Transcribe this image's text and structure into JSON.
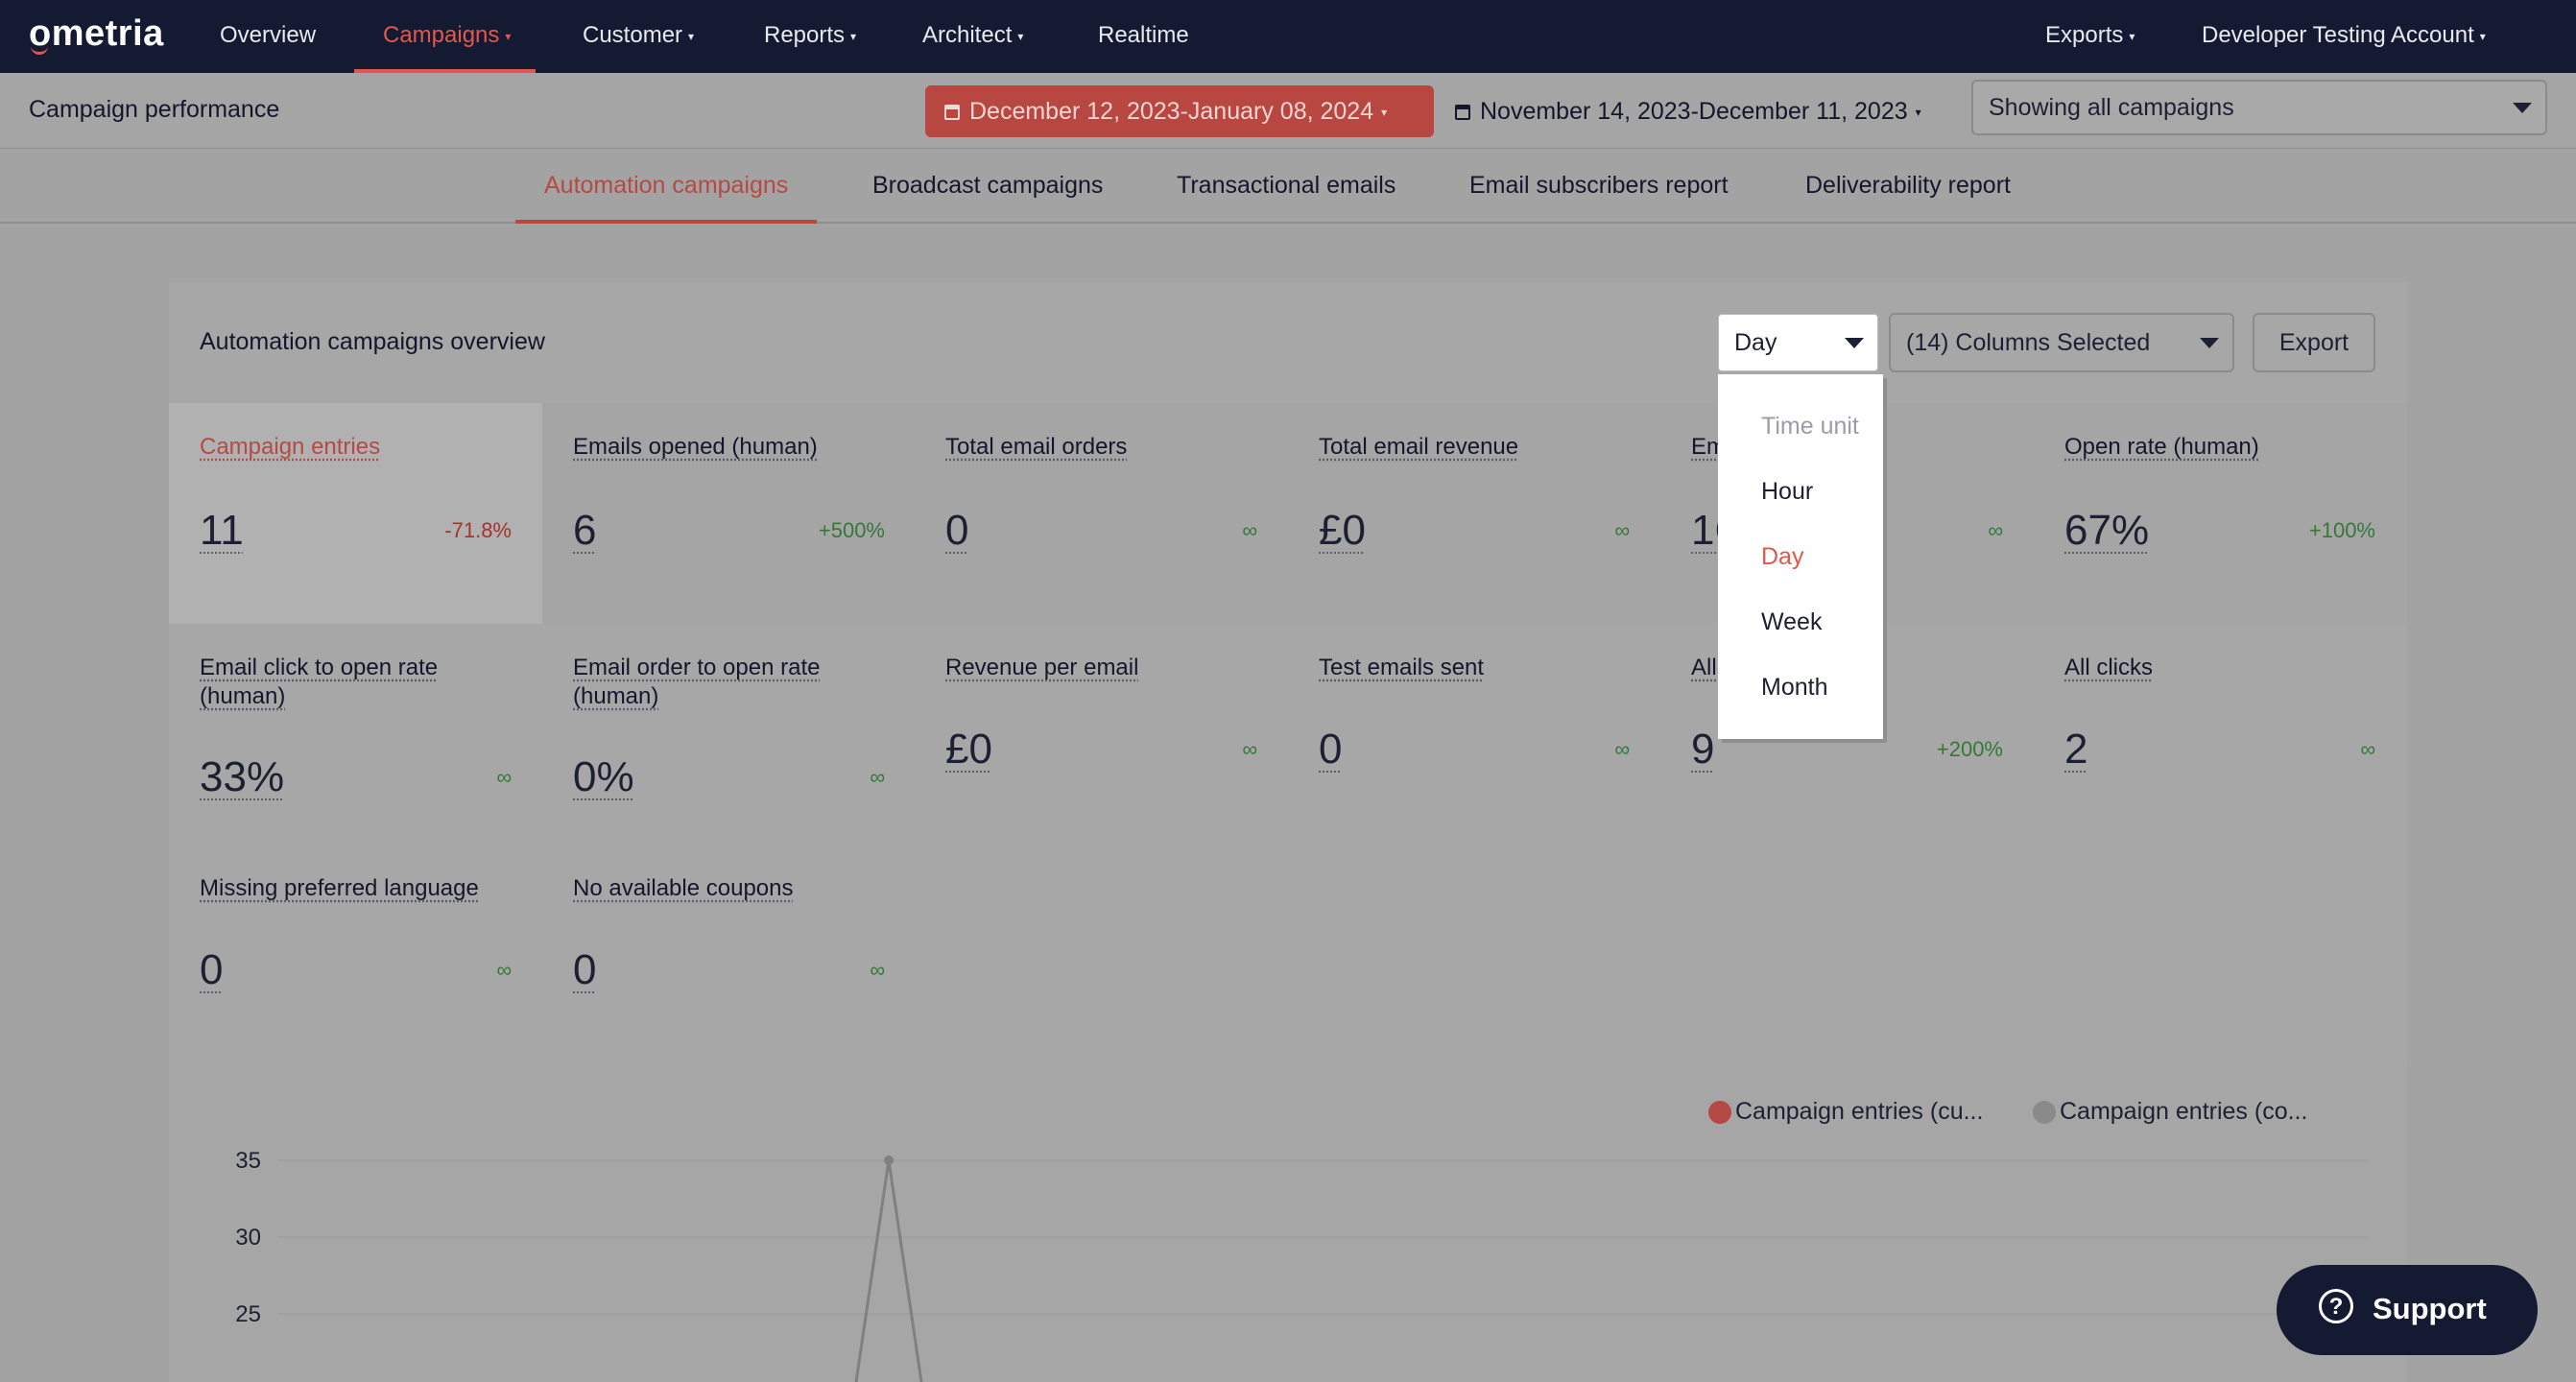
{
  "topnav": {
    "logo": "ometria",
    "items": [
      {
        "label": "Overview",
        "caret": false
      },
      {
        "label": "Campaigns",
        "caret": true
      },
      {
        "label": "Customer",
        "caret": true
      },
      {
        "label": "Reports",
        "caret": true
      },
      {
        "label": "Architect",
        "caret": true
      },
      {
        "label": "Realtime",
        "caret": false
      }
    ],
    "right_items": [
      {
        "label": "Exports"
      },
      {
        "label": "Developer Testing Account"
      }
    ],
    "active": "Campaigns"
  },
  "subbar": {
    "title": "Campaign performance",
    "date_range_current": "December 12, 2023-January 08, 2024",
    "date_range_compare": "November 14, 2023-December 11, 2023",
    "campaign_filter": "Showing all campaigns"
  },
  "tabs": [
    {
      "label": "Automation campaigns",
      "active": true
    },
    {
      "label": "Broadcast campaigns",
      "active": false
    },
    {
      "label": "Transactional emails",
      "active": false
    },
    {
      "label": "Email subscribers report",
      "active": false
    },
    {
      "label": "Deliverability report",
      "active": false
    }
  ],
  "overview": {
    "title": "Automation campaigns overview",
    "time_unit_value": "Day",
    "columns_selected": "(14) Columns Selected",
    "export_label": "Export"
  },
  "dropdown": {
    "header": "Time unit",
    "options": [
      "Hour",
      "Day",
      "Week",
      "Month"
    ],
    "selected": "Day"
  },
  "stats": [
    {
      "label": "Campaign entries",
      "value": "11",
      "change": "-71.8%",
      "trend": "negative",
      "highlighted": true
    },
    {
      "label": "Emails opened (human)",
      "value": "6",
      "change": "+500%",
      "trend": "positive"
    },
    {
      "label": "Total email orders",
      "value": "0",
      "change": "∞",
      "trend": "positive"
    },
    {
      "label": "Total email revenue",
      "value": "£0",
      "change": "∞",
      "trend": "positive"
    },
    {
      "label": "Em",
      "value": "1C",
      "change": "∞",
      "trend": "positive"
    },
    {
      "label": "Open rate (human)",
      "value": "67%",
      "change": "+100%",
      "trend": "positive"
    },
    {
      "label": "Email click to open rate (human)",
      "value": "33%",
      "change": "∞",
      "trend": "positive"
    },
    {
      "label": "Email order to open rate (human)",
      "value": "0%",
      "change": "∞",
      "trend": "positive"
    },
    {
      "label": "Revenue per email",
      "value": "£0",
      "change": "∞",
      "trend": "positive"
    },
    {
      "label": "Test emails sent",
      "value": "0",
      "change": "∞",
      "trend": "positive"
    },
    {
      "label": "All",
      "value": "9",
      "change": "+200%",
      "trend": "positive"
    },
    {
      "label": "All clicks",
      "value": "2",
      "change": "∞",
      "trend": "positive"
    },
    {
      "label": "Missing preferred language",
      "value": "0",
      "change": "∞",
      "trend": "positive"
    },
    {
      "label": "No available coupons",
      "value": "0",
      "change": "∞",
      "trend": "positive"
    }
  ],
  "chart_data": {
    "type": "line",
    "series": [
      {
        "name": "Campaign entries (cu...",
        "color": "#b54a44"
      },
      {
        "name": "Campaign entries (co...",
        "color": "#8a8a8b"
      }
    ],
    "y_ticks": [
      "35",
      "30",
      "25"
    ],
    "ylim_visible": [
      25,
      35
    ],
    "peak_value": 35
  },
  "support": {
    "label": "Support",
    "icon": "question-icon"
  }
}
